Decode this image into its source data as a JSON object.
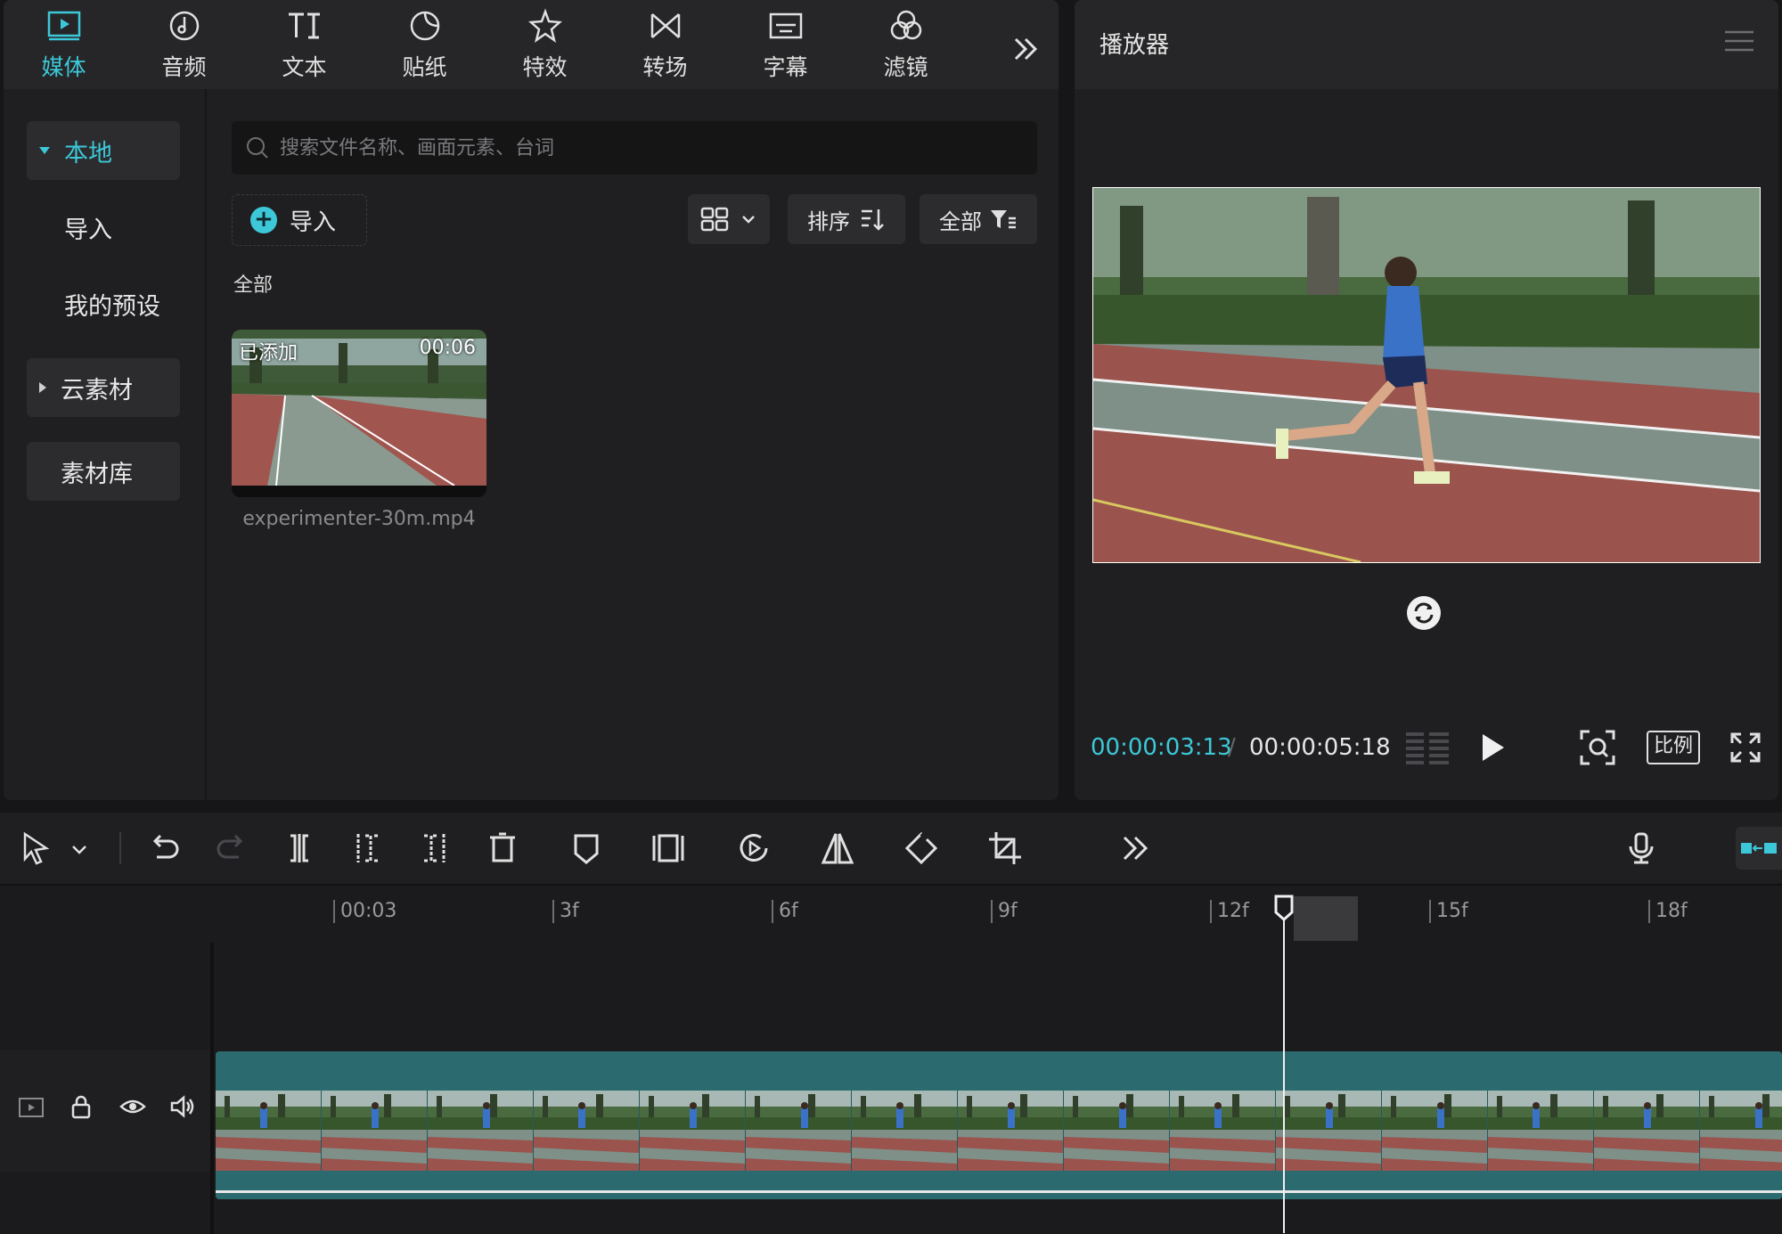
{
  "tabs": [
    {
      "label": "媒体",
      "icon": "media-icon",
      "active": true
    },
    {
      "label": "音频",
      "icon": "audio-icon"
    },
    {
      "label": "文本",
      "icon": "text-icon"
    },
    {
      "label": "贴纸",
      "icon": "sticker-icon"
    },
    {
      "label": "特效",
      "icon": "effects-icon"
    },
    {
      "label": "转场",
      "icon": "transition-icon"
    },
    {
      "label": "字幕",
      "icon": "subtitle-icon"
    },
    {
      "label": "滤镜",
      "icon": "filter-icon"
    }
  ],
  "sidebar": {
    "items": [
      {
        "label": "本地"
      },
      {
        "label": "导入"
      },
      {
        "label": "我的预设"
      },
      {
        "label": "云素材"
      },
      {
        "label": "素材库"
      }
    ]
  },
  "search": {
    "placeholder": "搜索文件名称、画面元素、台词"
  },
  "toolbar": {
    "import_label": "导入",
    "sort_label": "排序",
    "filter_label": "全部"
  },
  "media": {
    "section_label": "全部",
    "items": [
      {
        "badge": "已添加",
        "duration": "00:06",
        "filename": "experimenter-30m.mp4"
      }
    ]
  },
  "player": {
    "title": "播放器",
    "current_time": "00:00:03:13",
    "separator": "/",
    "total_time": "00:00:05:18",
    "ratio_label": "比例"
  },
  "timeline": {
    "ticks": [
      "00:03",
      "3f",
      "6f",
      "9f",
      "12f",
      "15f",
      "18f"
    ]
  },
  "colors": {
    "accent": "#3cc8d8",
    "track": "#2b6b6f",
    "panel": "#1f1f21"
  }
}
